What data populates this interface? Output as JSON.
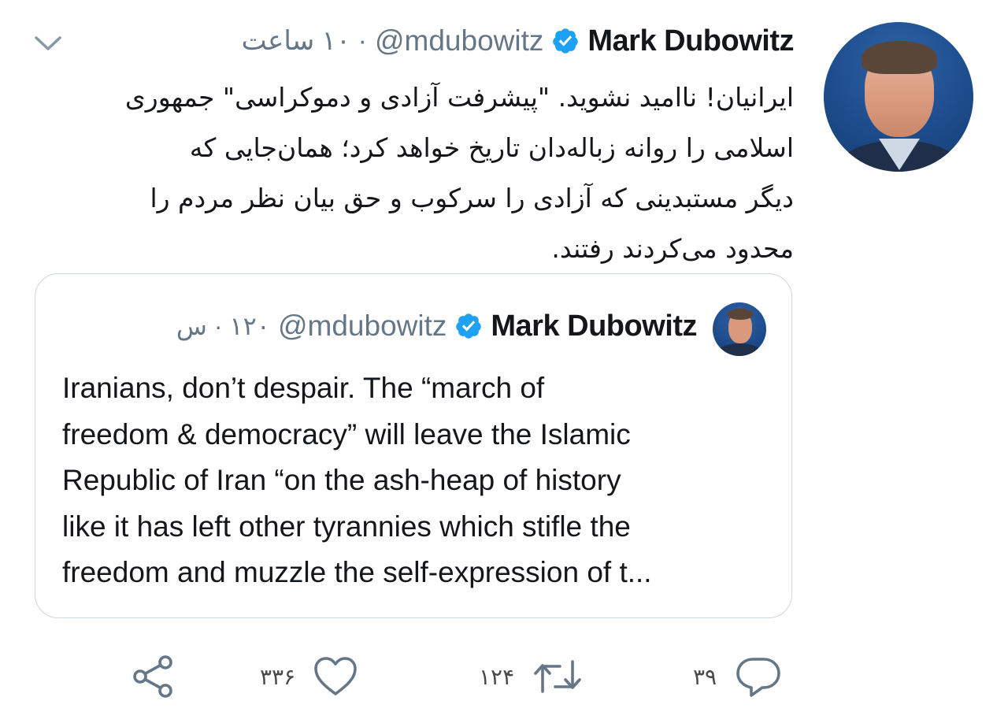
{
  "author": {
    "name": "Mark Dubowitz",
    "handle": "@mdubowitz",
    "time": "۱۰ ساعت",
    "verified": true
  },
  "tweet": {
    "lines": [
      "ایرانیان! ناامید نشوید. \"پیشرفت آزادی و دموکراسی\" جمهوری",
      "اسلامی را روانه زباله‌دان تاریخ خواهد کرد؛ همان‌جایی  که",
      "دیگر مستبدینی که آزادی را سرکوب و حق بیان نظر مردم را",
      "محدود می‌کردند رفتند."
    ]
  },
  "quoted": {
    "name": "Mark Dubowitz",
    "handle": "@mdubowitz",
    "time": "۱۲۰ · س",
    "lines": [
      "Iranians, don’t despair. The “march of",
      "freedom & democracy” will leave the Islamic",
      "Republic of Iran “on the ash-heap of history",
      "like it has left other tyrannies which stifle the",
      "freedom and muzzle the self-expression of t..."
    ]
  },
  "actions": {
    "replies": "۳۹",
    "retweets": "۱۲۴",
    "likes": "۳۳۶"
  },
  "colors": {
    "verified": "#1da1f2",
    "secondary_text": "#657786",
    "icon": "#657786",
    "border": "#ccd6dd"
  }
}
